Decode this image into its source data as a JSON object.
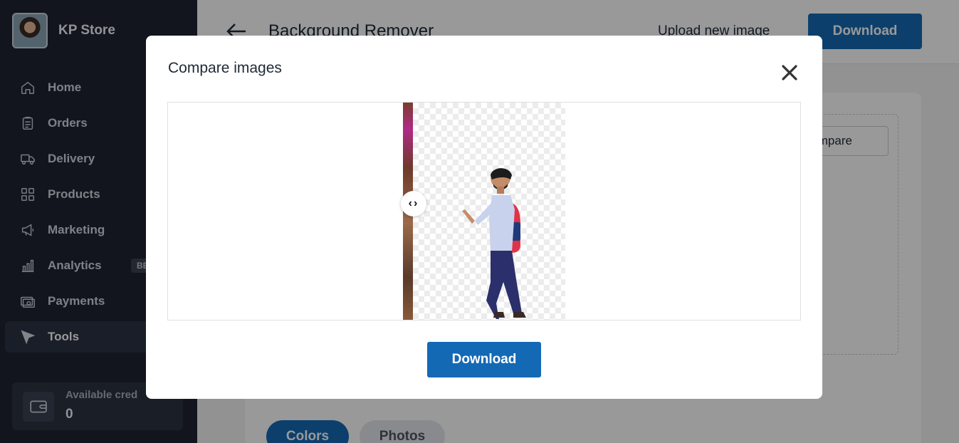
{
  "store": {
    "name": "KP Store"
  },
  "sidebar": {
    "items": [
      {
        "label": "Home",
        "icon": "home-icon"
      },
      {
        "label": "Orders",
        "icon": "clipboard-icon"
      },
      {
        "label": "Delivery",
        "icon": "truck-icon"
      },
      {
        "label": "Products",
        "icon": "grid-icon"
      },
      {
        "label": "Marketing",
        "icon": "megaphone-icon"
      },
      {
        "label": "Analytics",
        "icon": "bar-chart-icon",
        "badge": "BE"
      },
      {
        "label": "Payments",
        "icon": "cash-icon"
      },
      {
        "label": "Tools",
        "icon": "cursor-icon",
        "active": true
      }
    ],
    "credits": {
      "label": "Available cred",
      "value": "0",
      "icon": "wallet-icon"
    }
  },
  "header": {
    "title": "Background Remover",
    "upload_label": "Upload new image",
    "download_label": "Download"
  },
  "card": {
    "compare_label": "Compare",
    "tabs": [
      {
        "label": "Colors"
      },
      {
        "label": "Photos"
      }
    ]
  },
  "modal": {
    "title": "Compare images",
    "download_label": "Download",
    "slider_glyph": "‹›"
  },
  "colors": {
    "primary": "#1469b5",
    "sidebar_bg": "#1e2433"
  }
}
